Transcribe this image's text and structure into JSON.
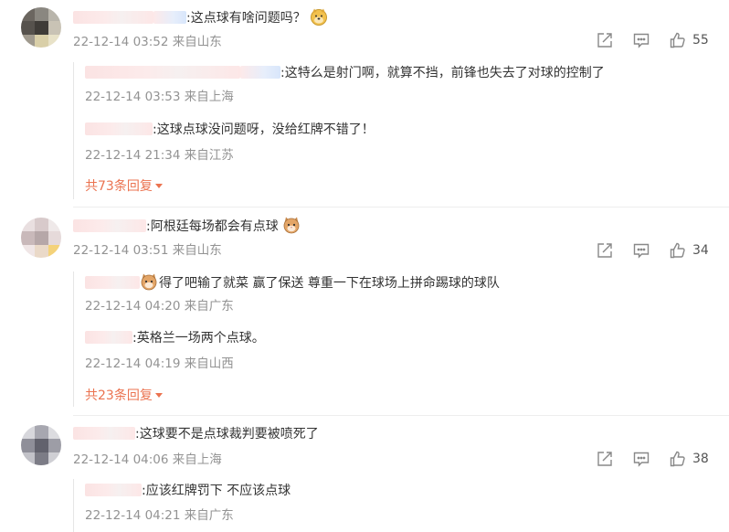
{
  "icons": {
    "share": "share-icon",
    "comment": "comment-icon",
    "like": "like-icon"
  },
  "comments": [
    {
      "text": ":这点球有啥问题吗？",
      "time": "22-12-14 03:52",
      "location": "来自山东",
      "likes": "55",
      "replies": [
        {
          "text": ":这特么是射门啊，就算不挡，前锋也失去了对球的控制了",
          "time": "22-12-14 03:53",
          "location": "来自上海"
        },
        {
          "text": ":这球点球没问题呀，没给红牌不错了！",
          "time": "22-12-14 21:34",
          "location": "来自江苏"
        }
      ],
      "more": "共73条回复"
    },
    {
      "text": ":阿根廷每场都会有点球",
      "time": "22-12-14 03:51",
      "location": "来自山东",
      "likes": "34",
      "replies": [
        {
          "text": "得了吧输了就菜 赢了保送 尊重一下在球场上拼命踢球的球队",
          "time": "22-12-14 04:20",
          "location": "来自广东"
        },
        {
          "text": ":英格兰一场两个点球。",
          "time": "22-12-14 04:19",
          "location": "来自山西"
        }
      ],
      "more": "共23条回复"
    },
    {
      "text": ":这球要不是点球裁判要被喷死了",
      "time": "22-12-14 04:06",
      "location": "来自上海",
      "likes": "38",
      "replies": [
        {
          "text": ":应该红牌罚下 不应该点球",
          "time": "22-12-14 04:21",
          "location": "来自广东"
        }
      ]
    }
  ]
}
